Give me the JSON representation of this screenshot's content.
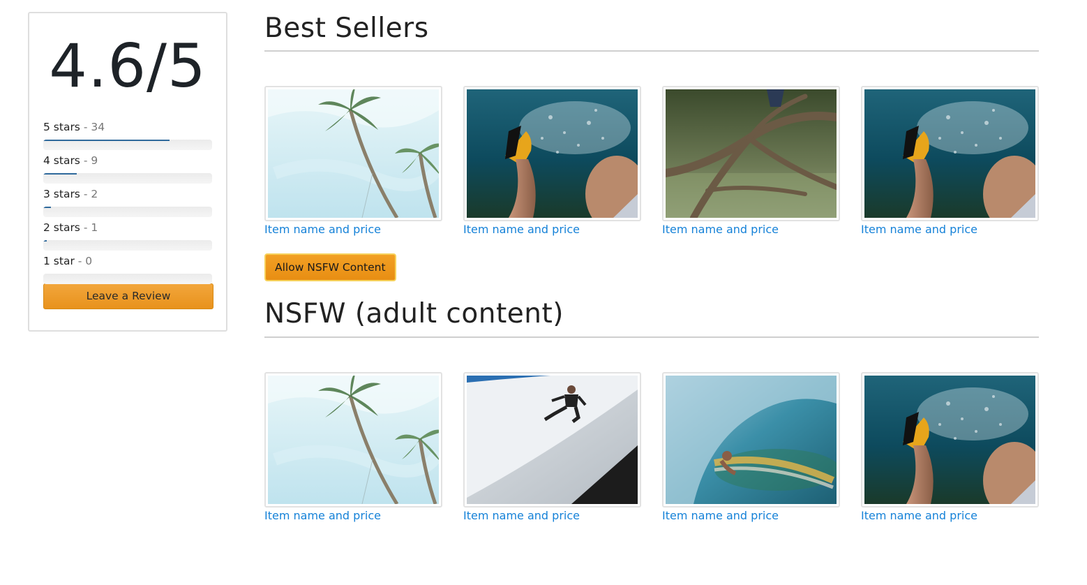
{
  "rating": {
    "score": "4.6/5",
    "rows": [
      {
        "label": "5 stars",
        "count": "- 34",
        "fraction": 0.747
      },
      {
        "label": "4 stars",
        "count": "- 9",
        "fraction": 0.198
      },
      {
        "label": "3 stars",
        "count": "- 2",
        "fraction": 0.044
      },
      {
        "label": "2 stars",
        "count": "- 1",
        "fraction": 0.022
      },
      {
        "label": "1 star",
        "count": "- 0",
        "fraction": 0.0
      }
    ],
    "review_button": "Leave a Review"
  },
  "best_sellers": {
    "title": "Best Sellers",
    "items": [
      {
        "label": "Item name and price",
        "image": "palm-trees-sky"
      },
      {
        "label": "Item name and price",
        "image": "underwater-fins"
      },
      {
        "label": "Item name and price",
        "image": "tree-branches"
      },
      {
        "label": "Item name and price",
        "image": "underwater-fins"
      }
    ]
  },
  "nsfw_button": "Allow NSFW Content",
  "nsfw": {
    "title": "NSFW (adult content)",
    "items": [
      {
        "label": "Item name and price",
        "image": "palm-trees-sky"
      },
      {
        "label": "Item name and price",
        "image": "skater-jump"
      },
      {
        "label": "Item name and price",
        "image": "surfer-wave"
      },
      {
        "label": "Item name and price",
        "image": "underwater-fins"
      }
    ]
  },
  "colors": {
    "accent_orange": "#e8921d",
    "link_blue": "#1682d8",
    "bar_blue": "#2f6a9c"
  }
}
